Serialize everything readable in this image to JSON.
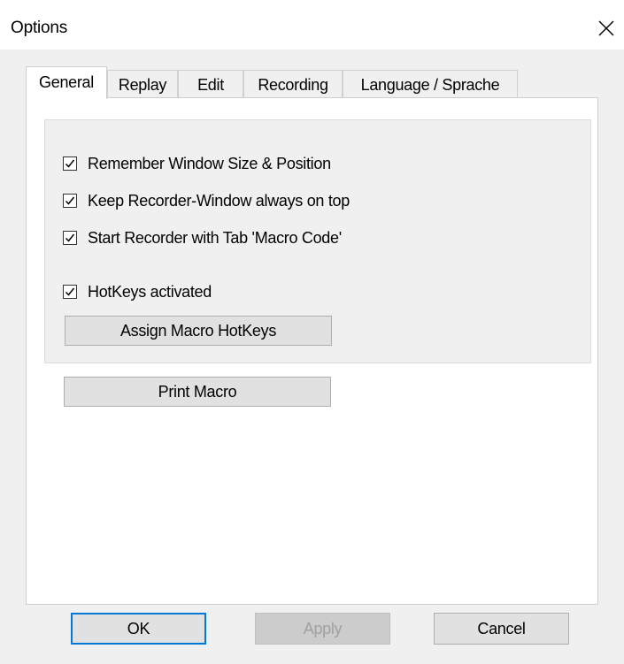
{
  "window": {
    "title": "Options"
  },
  "tabs": [
    {
      "label": "General",
      "active": true
    },
    {
      "label": "Replay",
      "active": false
    },
    {
      "label": "Edit",
      "active": false
    },
    {
      "label": "Recording",
      "active": false
    },
    {
      "label": "Language / Sprache",
      "active": false
    }
  ],
  "general": {
    "checkboxes": [
      {
        "label": "Remember Window Size & Position",
        "checked": true
      },
      {
        "label": "Keep Recorder-Window always on top",
        "checked": true
      },
      {
        "label": "Start Recorder with Tab 'Macro Code'",
        "checked": true
      },
      {
        "label": "HotKeys activated",
        "checked": true
      }
    ],
    "assign_hotkeys_label": "Assign Macro HotKeys",
    "print_macro_label": "Print Macro"
  },
  "footer": {
    "ok_label": "OK",
    "apply_label": "Apply",
    "cancel_label": "Cancel"
  },
  "colors": {
    "window_bg": "#f0f0f0",
    "focus_border": "#0078d7"
  }
}
